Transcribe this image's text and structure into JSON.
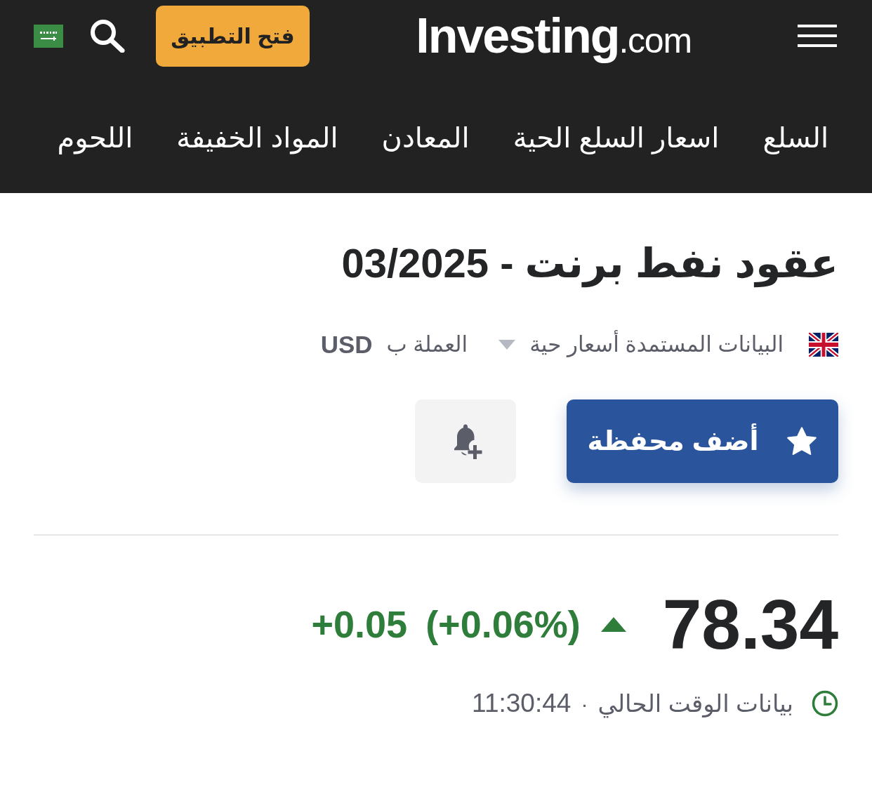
{
  "header": {
    "open_app_button": "فتح التطبيق",
    "logo": "**Investing**.com"
  },
  "nav": [
    "السلع",
    "اسعار السلع الحية",
    "المعادن",
    "المواد الخفيفة",
    "اللحوم"
  ],
  "instrument": {
    "title": "عقود نفط برنت - 03/2025",
    "data_source": "البيانات المستمدة أسعار حية",
    "currency_label": "العملة ب",
    "currency": "USD"
  },
  "actions": {
    "watchlist_button": "أضف محفظة"
  },
  "quote": {
    "price": "78.34",
    "rising": true,
    "change_percent": "(+0.06%)",
    "change": "+0.05",
    "time_label": "بيانات الوقت الحالي",
    "separator": "·",
    "time": "11:30:44"
  }
}
